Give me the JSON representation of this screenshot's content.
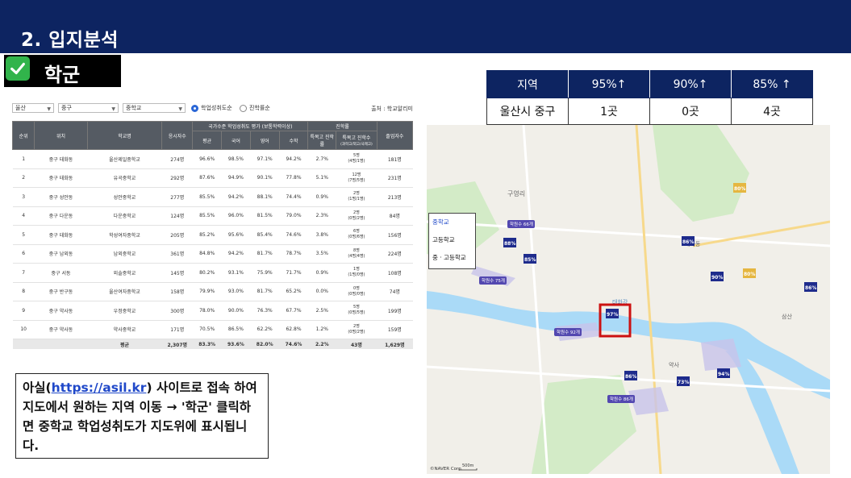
{
  "header": {
    "title": "2. 입지분석"
  },
  "section": {
    "label": "학군"
  },
  "summary": {
    "headers": [
      "지역",
      "95%↑",
      "90%↑",
      "85% ↑"
    ],
    "row": [
      "울산시 중구",
      "1곳",
      "0곳",
      "4곳"
    ]
  },
  "filters": {
    "city": "울산",
    "district": "중구",
    "school_type": "중학교",
    "radio_on": "학업성취도순",
    "radio_off": "진학률순",
    "source": "출처 : 학교알리미"
  },
  "table": {
    "headers_top": {
      "rank": "순위",
      "location": "위치",
      "school": "학교명",
      "takers": "응시자수",
      "group_achievement": "국가수준 학업성취도 평가 (보통학력이상)",
      "group_progress": "진학률",
      "admission": "졸업자수"
    },
    "headers_sub": {
      "avg": "평균",
      "korean": "국어",
      "english": "영어",
      "math": "수학",
      "special_rate": "특목고 진학률",
      "special_count": "특목고 진학수",
      "special_count_note": "(과학고/외고/국제고)"
    },
    "rows": [
      [
        "1",
        "중구 태화동",
        "울산제일중학교",
        "274명",
        "96.6%",
        "98.5%",
        "97.1%",
        "94.2%",
        "2.7%",
        "5명",
        "(4명/1명)",
        "181명"
      ],
      [
        "2",
        "중구 태화동",
        "유곡중학교",
        "292명",
        "87.6%",
        "94.9%",
        "90.1%",
        "77.8%",
        "5.1%",
        "12명",
        "(7명/5명)",
        "231명"
      ],
      [
        "3",
        "중구 성안동",
        "성안중학교",
        "277명",
        "85.5%",
        "94.2%",
        "88.1%",
        "74.4%",
        "0.9%",
        "2명",
        "(1명/1명)",
        "213명"
      ],
      [
        "4",
        "중구 다운동",
        "다운중학교",
        "124명",
        "85.5%",
        "96.0%",
        "81.5%",
        "79.0%",
        "2.3%",
        "2명",
        "(0명/2명)",
        "84명"
      ],
      [
        "5",
        "중구 태화동",
        "학성여자중학교",
        "205명",
        "85.2%",
        "95.6%",
        "85.4%",
        "74.6%",
        "3.8%",
        "6명",
        "(0명/6명)",
        "156명"
      ],
      [
        "6",
        "중구 남외동",
        "남외중학교",
        "361명",
        "84.8%",
        "94.2%",
        "81.7%",
        "78.7%",
        "3.5%",
        "8명",
        "(4명/4명)",
        "224명"
      ],
      [
        "7",
        "중구 서동",
        "외솔중학교",
        "145명",
        "80.2%",
        "93.1%",
        "75.9%",
        "71.7%",
        "0.9%",
        "1명",
        "(1명/0명)",
        "108명"
      ],
      [
        "8",
        "중구 반구동",
        "울산여자중학교",
        "158명",
        "79.9%",
        "93.0%",
        "81.7%",
        "65.2%",
        "0.0%",
        "0명",
        "(0명/0명)",
        "74명"
      ],
      [
        "9",
        "중구 약사동",
        "우정중학교",
        "300명",
        "78.0%",
        "90.0%",
        "76.3%",
        "67.7%",
        "2.5%",
        "5명",
        "(0명/5명)",
        "199명"
      ],
      [
        "10",
        "중구 약사동",
        "약사중학교",
        "171명",
        "70.5%",
        "86.5%",
        "62.2%",
        "62.8%",
        "1.2%",
        "2명",
        "(0명/2명)",
        "159명"
      ]
    ],
    "footer": {
      "label": "평균",
      "takers": "2,307명",
      "avg": "83.3%",
      "korean": "93.6%",
      "english": "82.0%",
      "math": "74.6%",
      "special_rate": "2.2%",
      "special_count": "43명",
      "graduates": "1,629명"
    }
  },
  "note": {
    "text1": "아실(",
    "link": "https://asil.kr",
    "text2": ") 사이트로 접속 하여  지도에서 원하는 지역 이동 → '학군' 클릭하면 중학교 학업성취도가 지도위에 표시됩니다."
  },
  "map": {
    "legend": [
      "중학교",
      "고등학교",
      "중 · 고등학교"
    ],
    "place_labels": [
      "구영리",
      "약사",
      "태화강",
      "태화동",
      "삼산"
    ],
    "copyright": "©NAVER Corp.",
    "scale": "500m",
    "markers": [
      "97%",
      "88%",
      "85%",
      "86%",
      "80%",
      "90%",
      "73%",
      "86%",
      "94%",
      "80%",
      "86%"
    ],
    "road_labels": [
      "학원수 66개",
      "학원수 75개",
      "학원수 92개",
      "학원수 86개"
    ],
    "colors": {
      "water": "#aadaf7",
      "land": "#f1efe9",
      "green": "#d3ebc7",
      "marker": "#1e2b8c",
      "highlight": "#cc1111"
    }
  }
}
